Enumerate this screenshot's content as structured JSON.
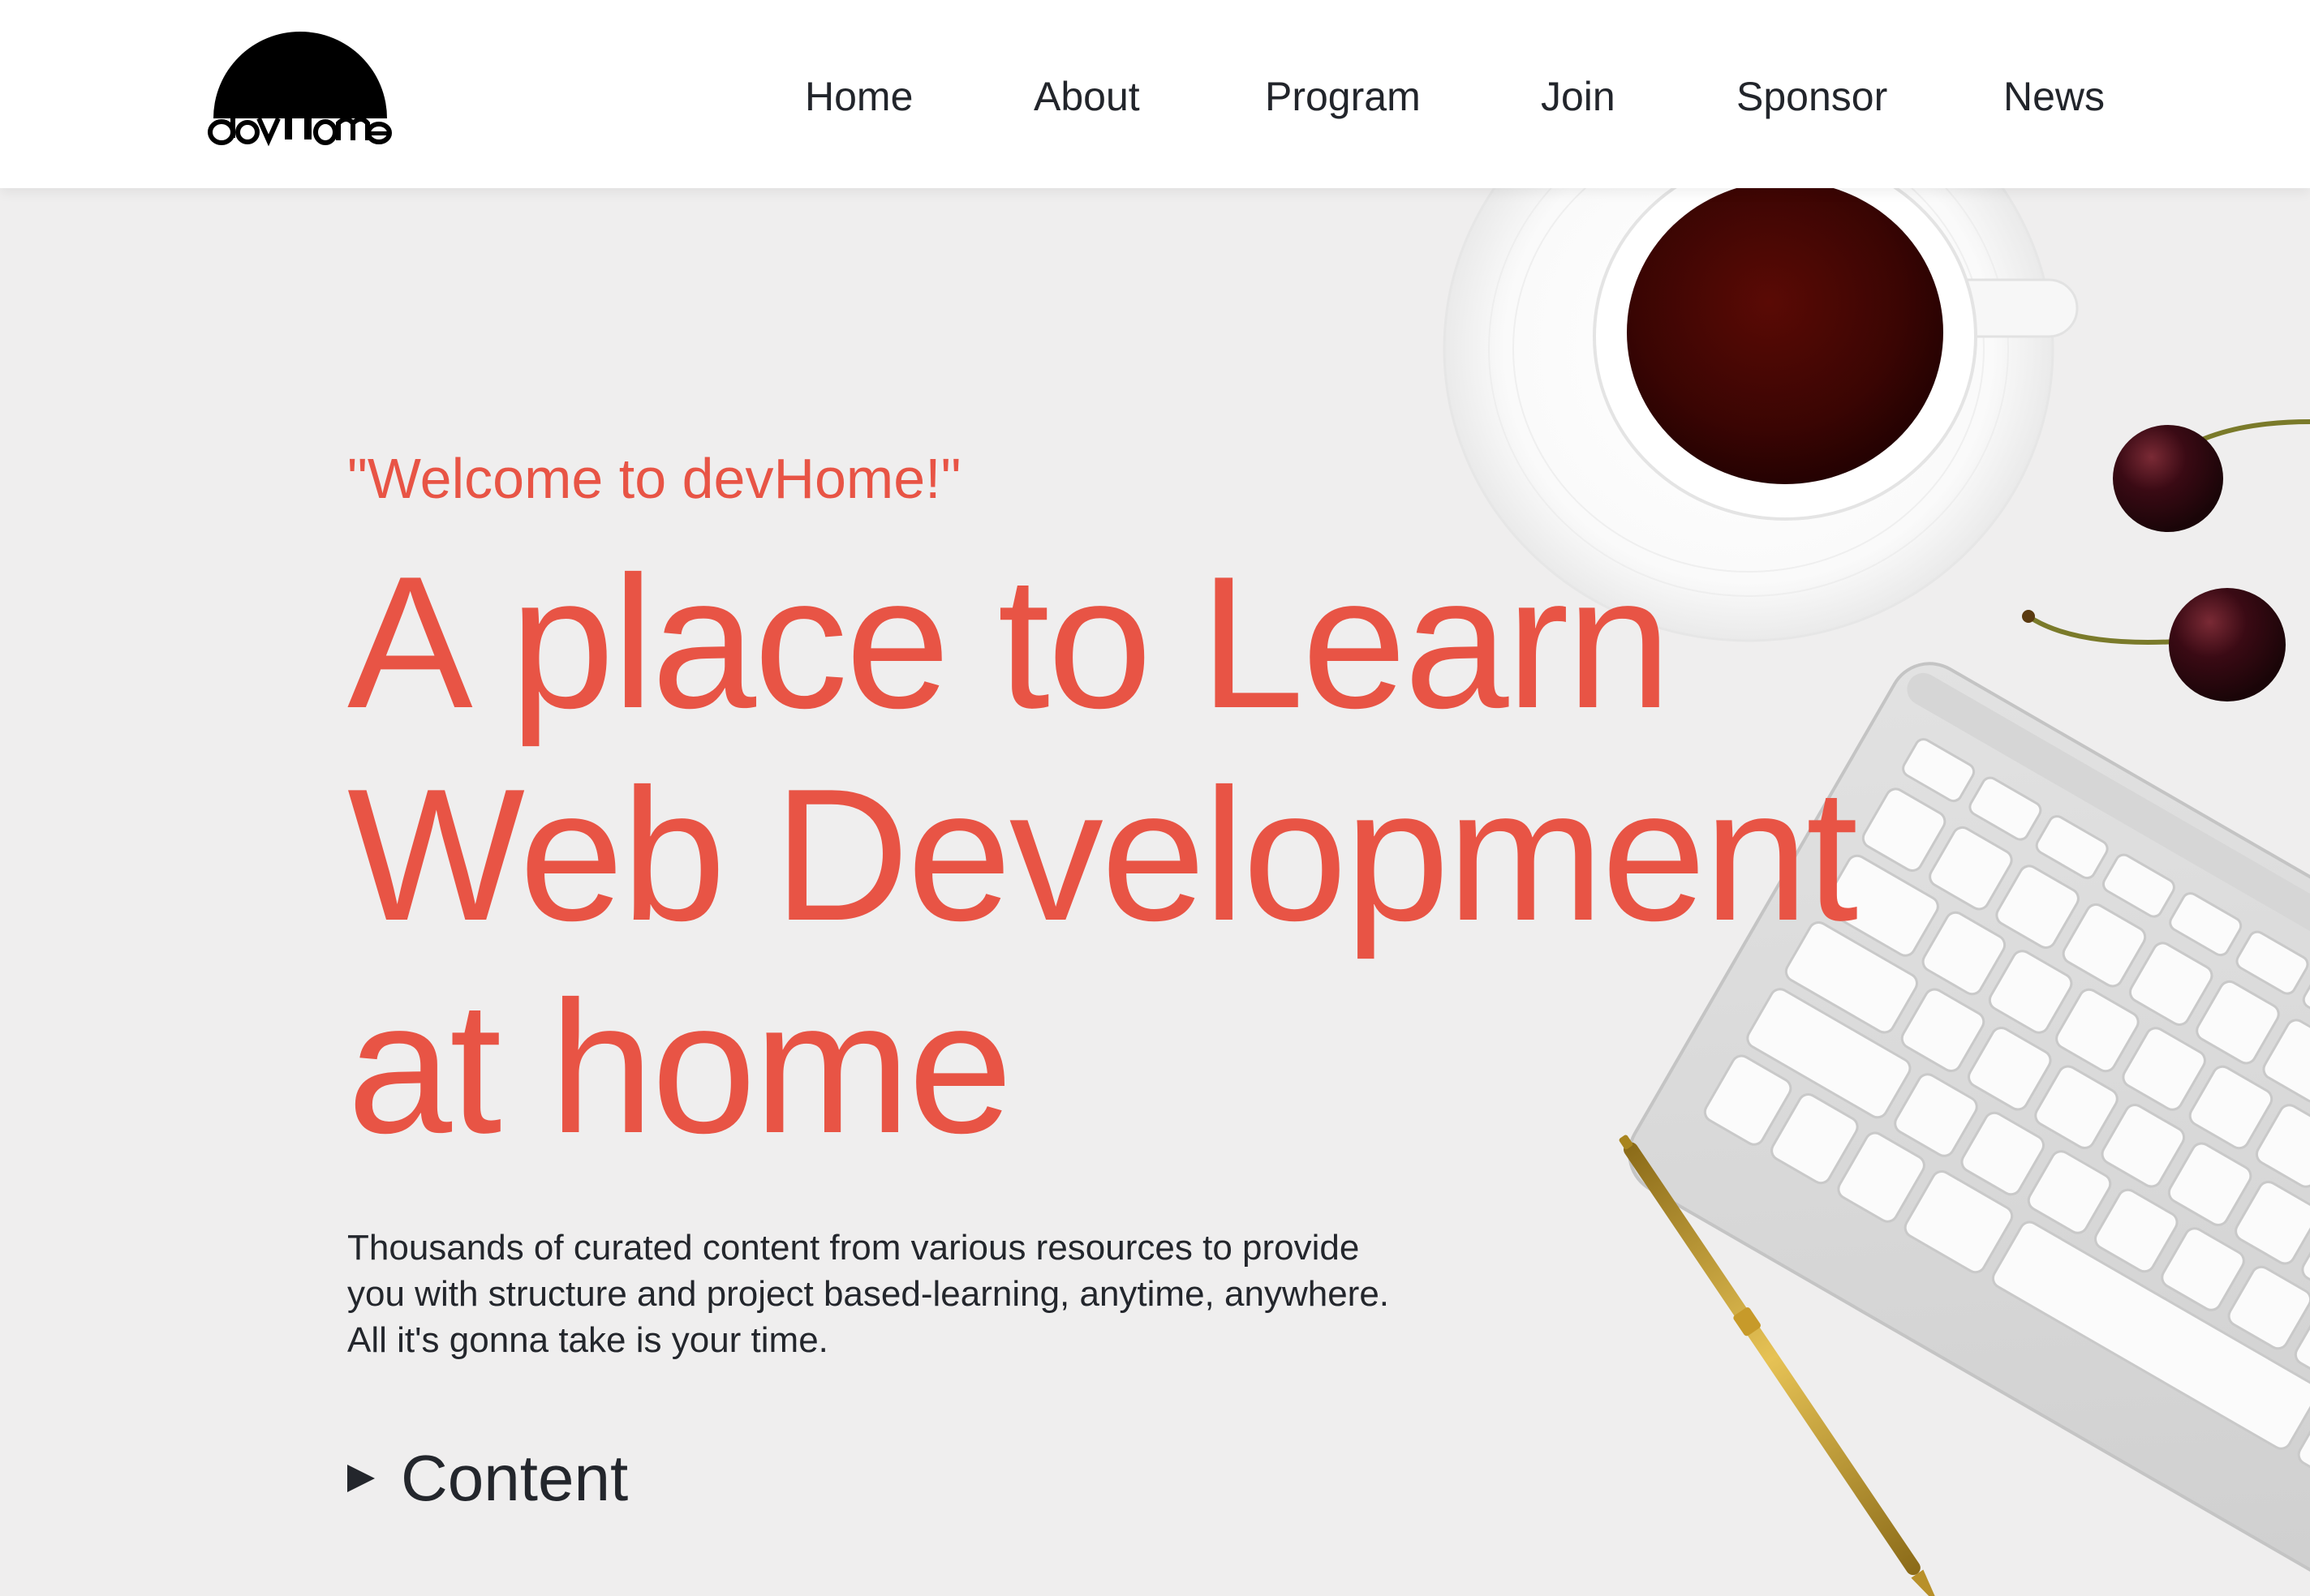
{
  "header": {
    "logo_text": "devHome",
    "nav": [
      {
        "label": "Home"
      },
      {
        "label": "About"
      },
      {
        "label": "Program"
      },
      {
        "label": "Join"
      },
      {
        "label": "Sponsor"
      },
      {
        "label": "News"
      }
    ]
  },
  "hero": {
    "welcome": "\"Welcome to devHome!\"",
    "headline_lines": [
      "A place to Learn",
      "Web Development",
      "at home"
    ],
    "description_lines": [
      "Thousands of curated content from various resources to provide",
      "you with structure and project based-learning, anytime, anywhere.",
      "All it's gonna take is your time."
    ],
    "content_toggle_label": "Content"
  },
  "colors": {
    "accent": "#e85445",
    "text_dark": "#23262c",
    "background": "#efeeee",
    "header_bg": "#ffffff"
  }
}
